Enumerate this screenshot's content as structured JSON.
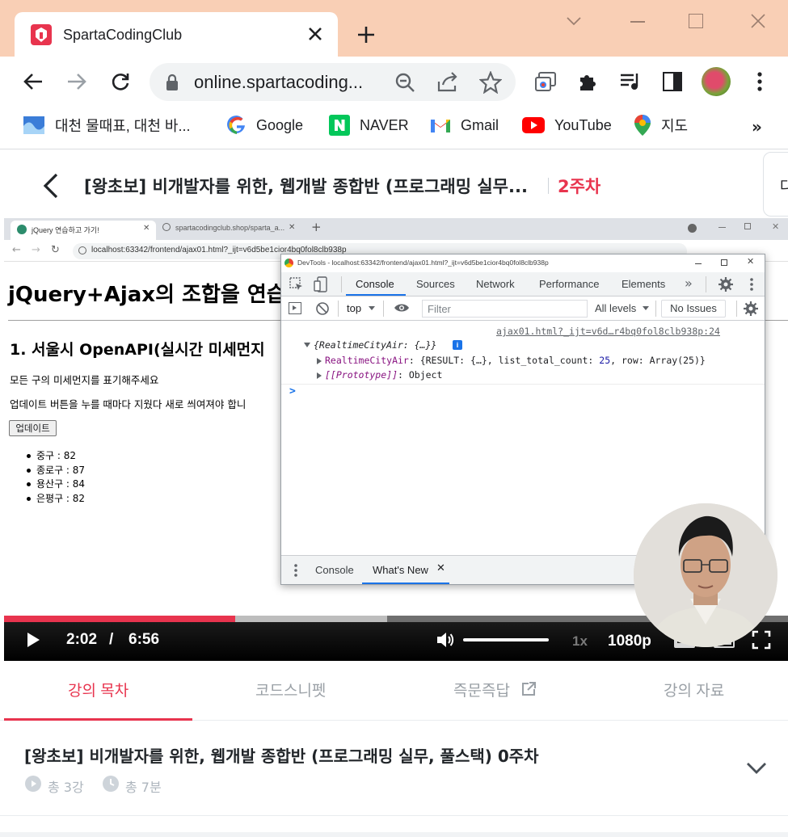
{
  "browser": {
    "tab_title": "SpartaCodingClub",
    "url": "online.spartacoding...",
    "bookmarks": [
      {
        "label": "대천 물때표, 대천 바..."
      },
      {
        "label": "Google"
      },
      {
        "label": "NAVER"
      },
      {
        "label": "Gmail"
      },
      {
        "label": "YouTube"
      },
      {
        "label": "지도"
      }
    ]
  },
  "course": {
    "title": "[왕초보] 비개발자를 위한, 웹개발 종합반 (프로그래밍 실무...",
    "week_badge": "2주차",
    "right_cut": "다"
  },
  "inner_browser": {
    "tabs": [
      {
        "label": "jQuery 연습하고 가기!"
      },
      {
        "label": "spartacodingclub.shop/sparta_a..."
      }
    ],
    "url": "localhost:63342/frontend/ajax01.html?_ijt=v6d5be1cior4bq0fol8clb938p"
  },
  "practice_page": {
    "heading": "jQuery+Ajax의 조합을 연습",
    "subheading": "1. 서울시 OpenAPI(실시간 미세먼지",
    "desc1": "모든 구의 미세먼지를 표기해주세요",
    "desc2": "업데이트 버튼을 누를 때마다 지웠다 새로 씌여져야 합니",
    "update_button": "업데이트",
    "items": [
      "중구 : 82",
      "종로구 : 87",
      "용산구 : 84",
      "은평구 : 82"
    ]
  },
  "devtools": {
    "title": "DevTools - localhost:63342/frontend/ajax01.html?_ijt=v6d5be1cior4bq0fol8clb938p",
    "tabs": [
      "Console",
      "Sources",
      "Network",
      "Performance",
      "Elements"
    ],
    "context": "top",
    "filter_placeholder": "Filter",
    "levels": "All levels",
    "issues": "No Issues",
    "source_link": "ajax01.html?_ijt=v6d…r4bq0fol8clb938p:24",
    "log_root": "{RealtimeCityAir: {…}}",
    "log_key": "RealtimeCityAir",
    "log_value_pre": ": {RESULT: {…}, list_total_count: ",
    "log_value_num": "25",
    "log_value_post": ", row: Array(25)}",
    "log_proto_key": "[[Prototype]]",
    "log_proto_val": ": Object",
    "prompt": ">",
    "drawer_tabs": [
      "Console",
      "What's New"
    ]
  },
  "player": {
    "current_time": "2:02",
    "separator": "/",
    "duration": "6:56",
    "speed": "1x",
    "quality": "1080p",
    "played_fraction": 0.295,
    "buffered_fraction": 0.489
  },
  "lecture_tabs": {
    "items": [
      "강의 목차",
      "코드스니펫",
      "즉문즉답",
      "강의 자료"
    ],
    "active": 0
  },
  "week_section": {
    "title": "[왕초보] 비개발자를 위한, 웹개발 종합반 (프로그래밍 실무, 풀스택) 0주차",
    "lessons": "총 3강",
    "duration": "총 7분"
  },
  "colors": {
    "brand_red": "#e8344e",
    "tabstrip": "#f9cfb5",
    "devtools_blue": "#1a73e8"
  }
}
